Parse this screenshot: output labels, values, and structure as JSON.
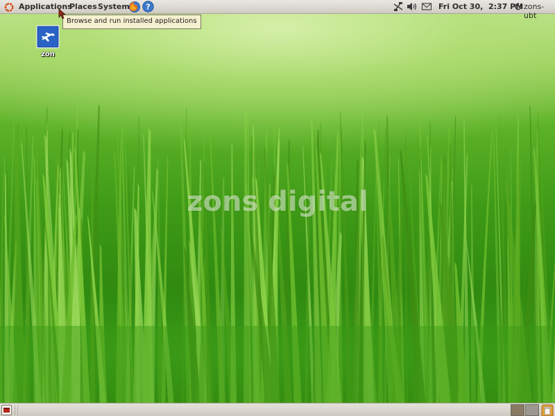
{
  "top_panel": {
    "menus": {
      "applications": "Applications",
      "places": "Places",
      "system": "System"
    },
    "launchers": [
      "firefox-icon",
      "help-icon"
    ],
    "tray_icons": [
      "network-disconnected-icon",
      "volume-icon",
      "mail-icon"
    ],
    "clock": "Fri Oct 30,  2:37 PM",
    "user": "zons-ubt"
  },
  "tooltip": {
    "text": "Browse and run installed applications"
  },
  "desktop": {
    "icons": [
      {
        "label": "zon",
        "icon": "airplane-icon"
      }
    ],
    "watermark": "zons digital"
  },
  "bottom_panel": {
    "workspaces": 2,
    "active_workspace": 1
  },
  "colors": {
    "panel_bg": "#dcd9d2",
    "tooltip_bg": "#f5f1d0",
    "ubuntu_orange": "#dd4814",
    "grass_green": "#3e9a16"
  }
}
